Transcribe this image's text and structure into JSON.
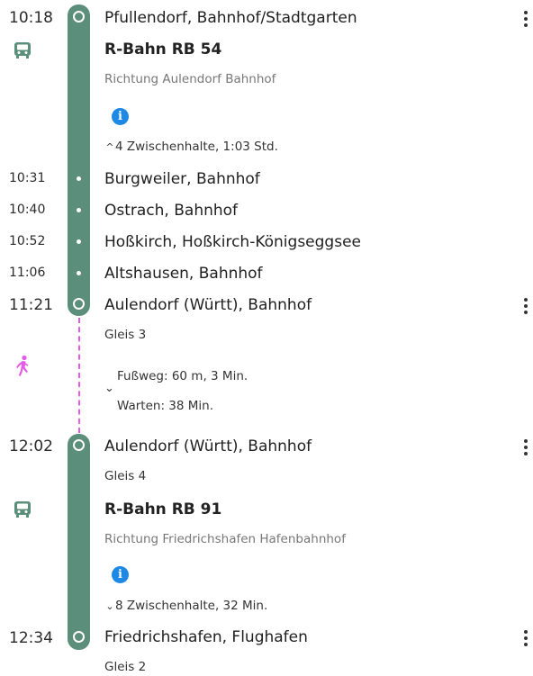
{
  "leg1": {
    "departure": {
      "time": "10:18",
      "station": "Pfullendorf, Bahnhof/Stadtgarten"
    },
    "train": "R-Bahn RB 54",
    "direction": "Richtung Aulendorf Bahnhof",
    "info_glyph": "i",
    "stops_toggle": {
      "chevron": "^",
      "label": "4 Zwischenhalte, 1:03 Std."
    },
    "stops": [
      {
        "time": "10:31",
        "station": "Burgweiler, Bahnhof"
      },
      {
        "time": "10:40",
        "station": "Ostrach, Bahnhof"
      },
      {
        "time": "10:52",
        "station": "Hoßkirch, Hoßkirch-Königseggsee"
      },
      {
        "time": "11:06",
        "station": "Altshausen, Bahnhof"
      }
    ],
    "arrival": {
      "time": "11:21",
      "station": "Aulendorf (Württ), Bahnhof",
      "platform": "Gleis 3"
    }
  },
  "transfer": {
    "walk_label": "Fußweg: 60 m, 3 Min.",
    "wait_label": "Warten: 38 Min.",
    "chevron": "⌄",
    "walk_color": "#e55be5"
  },
  "leg2": {
    "departure": {
      "time": "12:02",
      "station": "Aulendorf (Württ), Bahnhof",
      "platform": "Gleis 4"
    },
    "train": "R-Bahn RB 91",
    "direction": "Richtung Friedrichshafen Hafenbahnhof",
    "info_glyph": "i",
    "stops_toggle": {
      "chevron": "⌄",
      "label": "8 Zwischenhalte, 32 Min."
    },
    "arrival": {
      "time": "12:34",
      "station": "Friedrichshafen, Flughafen",
      "platform": "Gleis 2"
    }
  },
  "icons": {
    "train": "train-icon",
    "walk": "walking-person-icon",
    "info": "info-icon",
    "more": "more-vertical-icon"
  },
  "colors": {
    "line": "#5b8f7b",
    "info": "#1e88e5",
    "walk": "#e55be5"
  }
}
